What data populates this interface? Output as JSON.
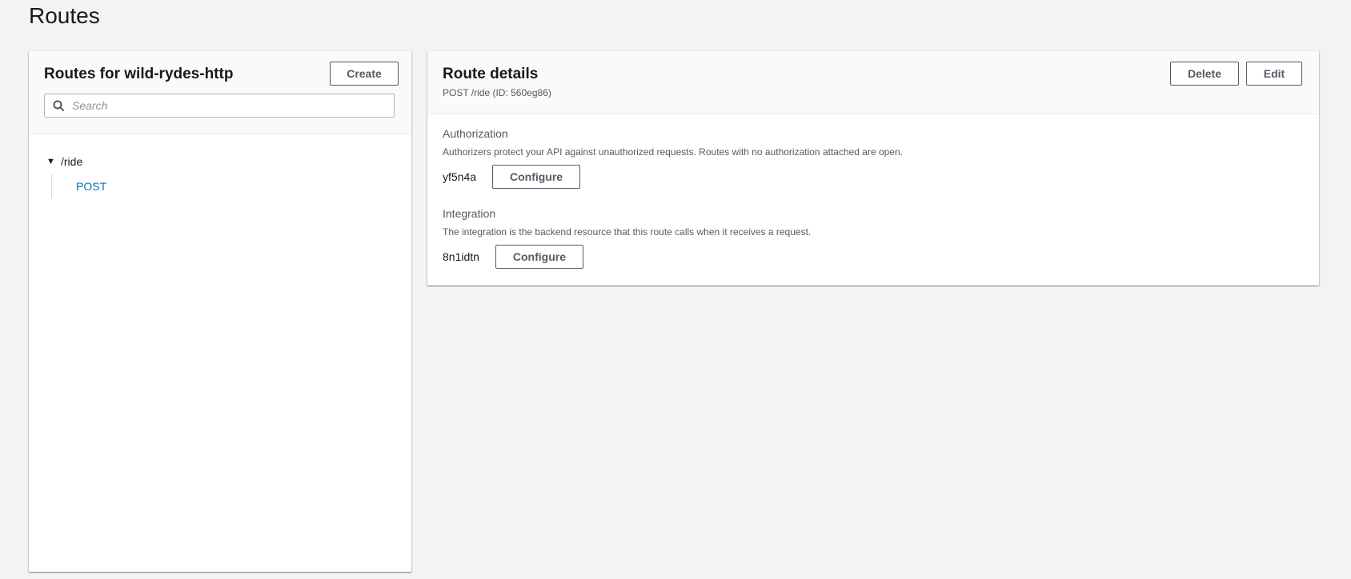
{
  "page": {
    "title": "Routes"
  },
  "left_panel": {
    "title": "Routes for wild-rydes-http",
    "create_label": "Create",
    "search_placeholder": "Search",
    "tree": {
      "path": "/ride",
      "methods": [
        "POST"
      ]
    }
  },
  "right_panel": {
    "title": "Route details",
    "subtitle": "POST /ride (ID: 560eg86)",
    "delete_label": "Delete",
    "edit_label": "Edit",
    "authorization": {
      "label": "Authorization",
      "description": "Authorizers protect your API against unauthorized requests. Routes with no authorization attached are open.",
      "id": "yf5n4a",
      "button_label": "Configure"
    },
    "integration": {
      "label": "Integration",
      "description": "The integration is the backend resource that this route calls when it receives a request.",
      "id": "8n1idtn",
      "button_label": "Configure"
    }
  },
  "colors": {
    "background": "#f2f3f3",
    "link": "#0073bb",
    "button_border": "#545b64"
  },
  "icons": {
    "search": "search-icon",
    "caret": "caret-down-icon"
  }
}
